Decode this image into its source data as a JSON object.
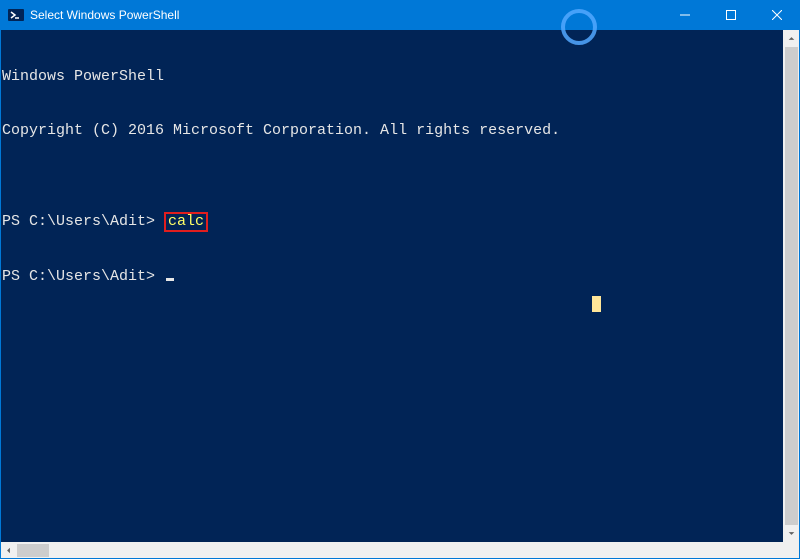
{
  "titlebar": {
    "title": "Select Windows PowerShell"
  },
  "console": {
    "banner1": "Windows PowerShell",
    "banner2": "Copyright (C) 2016 Microsoft Corporation. All rights reserved.",
    "blank": "",
    "prompt1": "PS C:\\Users\\Adit> ",
    "command1": "calc",
    "prompt2": "PS C:\\Users\\Adit> "
  },
  "colors": {
    "titlebar_bg": "#0078d7",
    "console_bg": "#012456",
    "console_fg": "#e6e6e6",
    "cmd_fg": "#ffff66",
    "highlight_border": "#e01e1e"
  },
  "icons": {
    "app": "powershell-icon",
    "minimize": "minimize-icon",
    "maximize": "maximize-icon",
    "close": "close-icon",
    "scroll_up": "chevron-up-icon",
    "scroll_down": "chevron-down-icon",
    "scroll_left": "chevron-left-icon",
    "scroll_right": "chevron-right-icon"
  }
}
